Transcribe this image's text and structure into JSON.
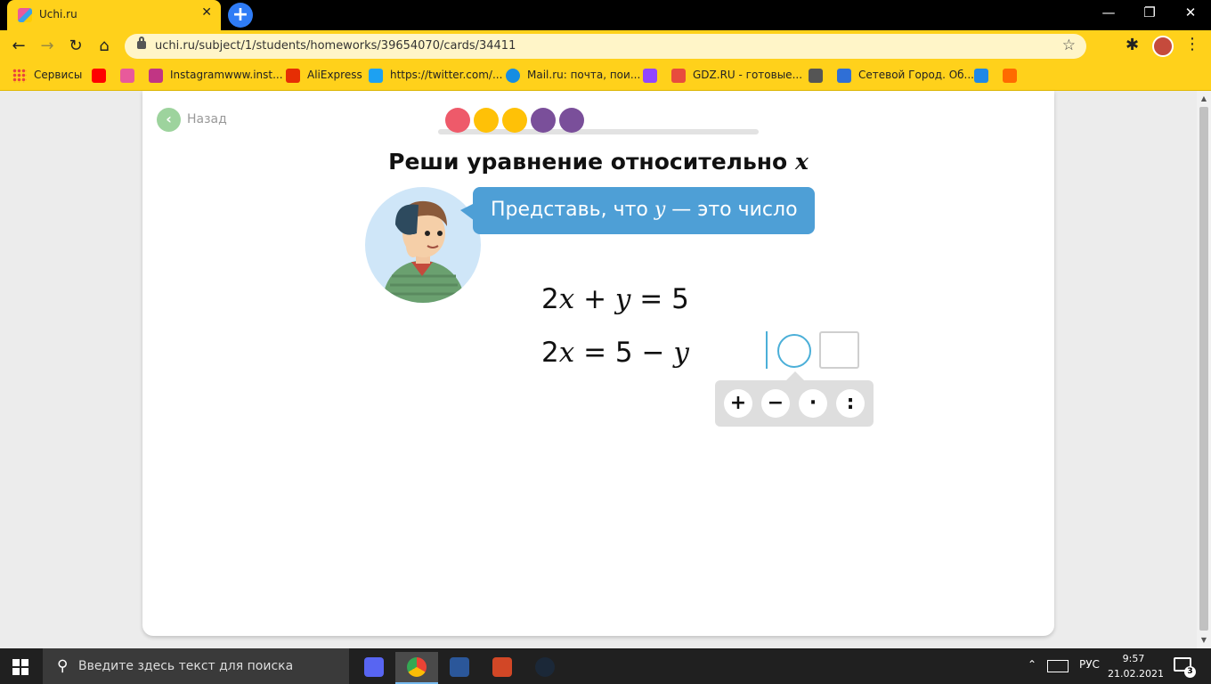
{
  "browser": {
    "tab": {
      "title": "Uchi.ru",
      "close": "✕"
    },
    "new_tab": "+",
    "window_controls": {
      "minimize": "—",
      "restore": "❐",
      "close": "✕"
    },
    "url": "uchi.ru/subject/1/students/homeworks/39654070/cards/34411",
    "bookmarks": [
      {
        "label": "Сервисы",
        "icon_color": "#e8453c"
      },
      {
        "label": "",
        "icon_color": "#ff0000"
      },
      {
        "label": "",
        "icon_color": "#e85a9b"
      },
      {
        "label": "Instagramwww.inst...",
        "icon_color": "#c13584"
      },
      {
        "label": "AliExpress",
        "icon_color": "#e62e04"
      },
      {
        "label": "https://twitter.com/...",
        "icon_color": "#1da1f2"
      },
      {
        "label": "Mail.ru: почта, пои...",
        "icon_color": "#168de2"
      },
      {
        "label": "",
        "icon_color": "#9146ff"
      },
      {
        "label": "GDZ.RU - готовые...",
        "icon_color": "#e84c3d"
      },
      {
        "label": "",
        "icon_color": "#555555"
      },
      {
        "label": "Сетевой Город. Об...",
        "icon_color": "#2f6fd6"
      },
      {
        "label": "",
        "icon_color": "#1e88e5"
      },
      {
        "label": "",
        "icon_color": "#ff6a00"
      }
    ]
  },
  "page": {
    "back_label": "Назад",
    "progress_dots": [
      "#ee5a6a",
      "#ffc107",
      "#ffc107",
      "#7a4f9a",
      "#7a4f9a"
    ],
    "title_text": "Реши уравнение относительно ",
    "title_var": "x",
    "hint": {
      "before": "Представь, что ",
      "var": "y",
      "after": " — это число"
    },
    "equations": [
      {
        "coef": "2",
        "var1": "x",
        "middle": " + ",
        "var2": "y",
        "right": " = 5"
      },
      {
        "coef": "2",
        "var1": "x",
        "middle": " = 5 − ",
        "var2": "y",
        "right": ""
      }
    ],
    "operators": [
      "+",
      "−",
      "·",
      ":"
    ]
  },
  "taskbar": {
    "search_placeholder": "Введите здесь текст для поиска",
    "language": "РУС",
    "time": "9:57",
    "date": "21.02.2021",
    "notifications_count": "3",
    "apps": [
      {
        "name": "discord",
        "color": "#5865f2"
      },
      {
        "name": "chrome",
        "color": "#34a853"
      },
      {
        "name": "word",
        "color": "#2b579a"
      },
      {
        "name": "powerpoint",
        "color": "#d24726"
      },
      {
        "name": "steam",
        "color": "#1b2838"
      }
    ]
  }
}
